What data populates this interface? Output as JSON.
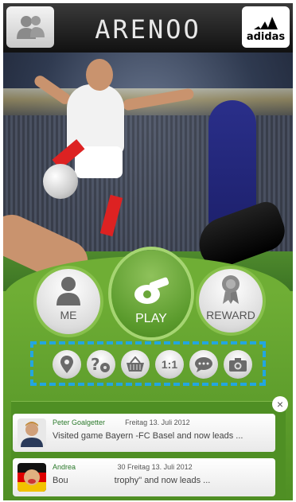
{
  "app": {
    "title": "ARENOO",
    "brand": "adidas"
  },
  "header": {
    "left_icon": "users-icon",
    "right_icon": "adidas-logo"
  },
  "main_buttons": {
    "me": {
      "label": "ME",
      "icon": "person-icon"
    },
    "play": {
      "label": "PLAY",
      "icon": "whistle-icon"
    },
    "reward": {
      "label": "REWARD",
      "icon": "medal-icon"
    }
  },
  "small_buttons": [
    {
      "name": "location-pin-icon",
      "glyph": "⚲"
    },
    {
      "name": "quiz-ball-icon",
      "glyph": "?⚽"
    },
    {
      "name": "basket-icon",
      "glyph": "▭"
    },
    {
      "name": "one-on-one-icon",
      "glyph": "1:1"
    },
    {
      "name": "chat-bubble-icon",
      "glyph": "…"
    },
    {
      "name": "camera-icon",
      "glyph": "◘"
    }
  ],
  "feed": [
    {
      "name": "Peter Goalgetter",
      "time": "Freitag 13. Juli 2012",
      "text": "Visited game Bayern -FC Basel and now leads ..."
    },
    {
      "name": "Andrea",
      "time": "30 Freitag 13. Juli 2012",
      "text": "trophy\" and now leads ..."
    }
  ],
  "feed_prefix": {
    "card1_time_pre": "",
    "card2_text_pre": "Bou"
  },
  "close_label": "×",
  "colors": {
    "accent": "#6fae35",
    "highlight": "#23a6e0"
  }
}
